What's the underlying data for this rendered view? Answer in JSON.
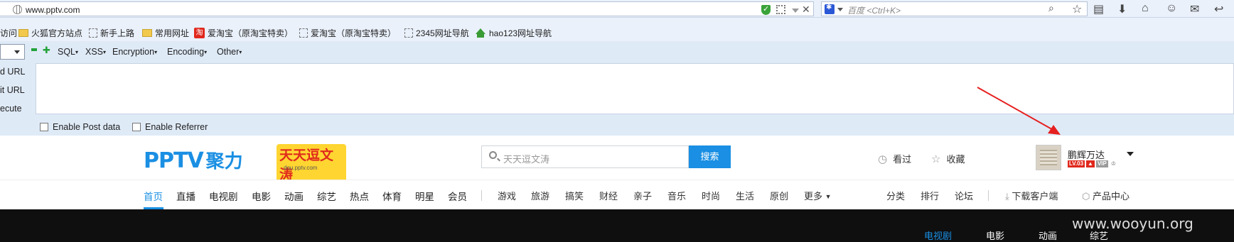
{
  "browser": {
    "url": "www.pptv.com",
    "search_placeholder": "百度 <Ctrl+K>"
  },
  "bookmarks": [
    {
      "label": "访问",
      "icon": "none"
    },
    {
      "label": "火狐官方站点",
      "icon": "folder-icon"
    },
    {
      "label": "新手上路",
      "icon": "page-icon"
    },
    {
      "label": "常用网址",
      "icon": "folder-icon"
    },
    {
      "label": "爱淘宝（原淘宝特卖）",
      "icon": "taobao-icon"
    },
    {
      "label": "爱淘宝（原淘宝特卖）",
      "icon": "page-icon"
    },
    {
      "label": "2345网址导航",
      "icon": "page-icon"
    },
    {
      "label": "hao123网址导航",
      "icon": "hao123-icon"
    }
  ],
  "hackbar": {
    "menus": [
      "SQL",
      "XSS",
      "Encryption",
      "Encoding",
      "Other"
    ],
    "actions": [
      "d URL",
      "it URL",
      "ecute"
    ],
    "checkboxes": [
      "Enable Post data",
      "Enable Referrer"
    ]
  },
  "site": {
    "logo": "PPTV",
    "logo_suffix": "聚力",
    "promo_title": "天天逗文涛",
    "promo_sub": "dou.pptv.com",
    "search_placeholder": "天天逗文涛",
    "search_button": "搜索",
    "history_label": "看过",
    "favorites_label": "收藏",
    "username": "鹏辉万达",
    "badges": [
      "LV.03",
      "VIP"
    ]
  },
  "nav": {
    "primary": [
      "首页",
      "直播",
      "电视剧",
      "电影",
      "动画",
      "综艺",
      "热点",
      "体育",
      "明星",
      "会员"
    ],
    "secondary": [
      "游戏",
      "旅游",
      "搞笑",
      "财经",
      "亲子",
      "音乐",
      "时尚",
      "生活",
      "原创",
      "更多"
    ],
    "right": [
      "分类",
      "排行",
      "论坛",
      "下载客户端",
      "产品中心"
    ]
  },
  "subnav": [
    "电视剧",
    "电影",
    "动画",
    "综艺"
  ],
  "watermark": "www.wooyun.org",
  "colors": {
    "brand": "#1a8fe3",
    "hackbar_bg": "#dfeaf7",
    "dark": "#0f0f10"
  }
}
